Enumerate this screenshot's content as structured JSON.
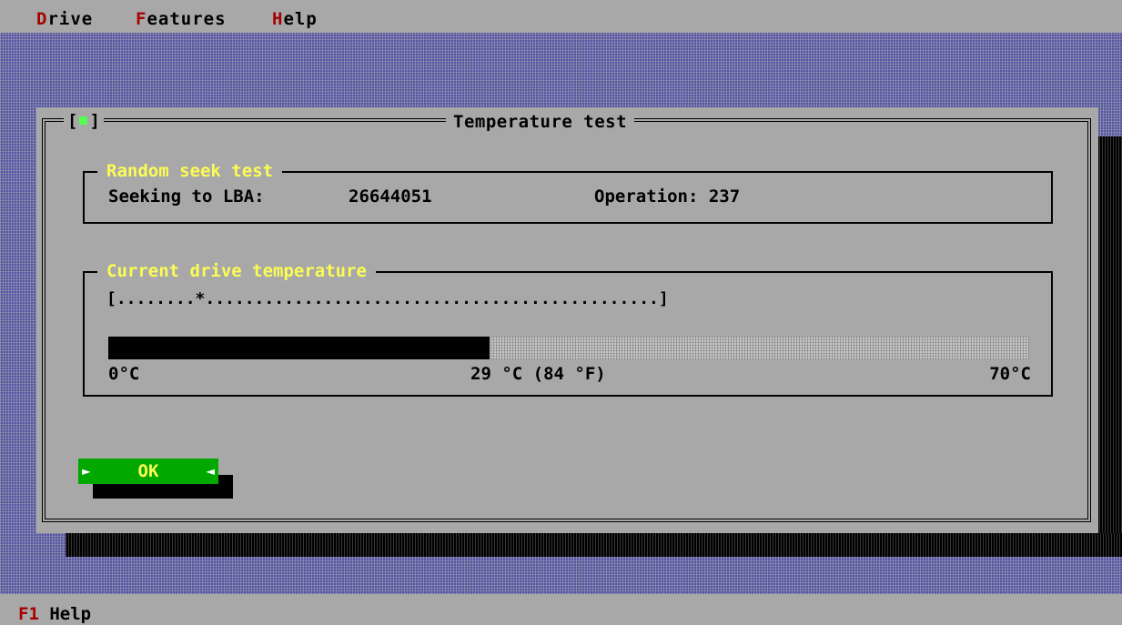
{
  "menu": {
    "items": [
      {
        "hotkey": "D",
        "rest": "rive"
      },
      {
        "hotkey": "F",
        "rest": "eatures"
      },
      {
        "hotkey": "H",
        "rest": "elp"
      }
    ]
  },
  "window": {
    "close_box_left": "[",
    "close_box_right": "]",
    "title": "Temperature test"
  },
  "seek_group": {
    "label": "Random seek test",
    "seeking_label": "Seeking to LBA:",
    "lba_value": "26644051",
    "operation_label": "Operation: 237"
  },
  "temp_group": {
    "label": "Current drive temperature",
    "scale_line": "[........*..............................................]",
    "min_label": "0°C",
    "current_label": "29 °C (84 °F)",
    "max_label": "70°C",
    "current_c": 29,
    "min_c": 0,
    "max_c": 70
  },
  "ok_button": {
    "label": "OK",
    "arrow_left": "►",
    "arrow_right": "◄"
  },
  "statusbar": {
    "hotkey": "F1",
    "label": " Help"
  },
  "colors": {
    "dialog_bg": "#a8a8a8",
    "desktop": "#5454a8",
    "group_label": "#fcfc54",
    "hotkey": "#a80000",
    "button": "#00a800",
    "button_text": "#fcfc54",
    "close_indicator": "#54fc54"
  }
}
